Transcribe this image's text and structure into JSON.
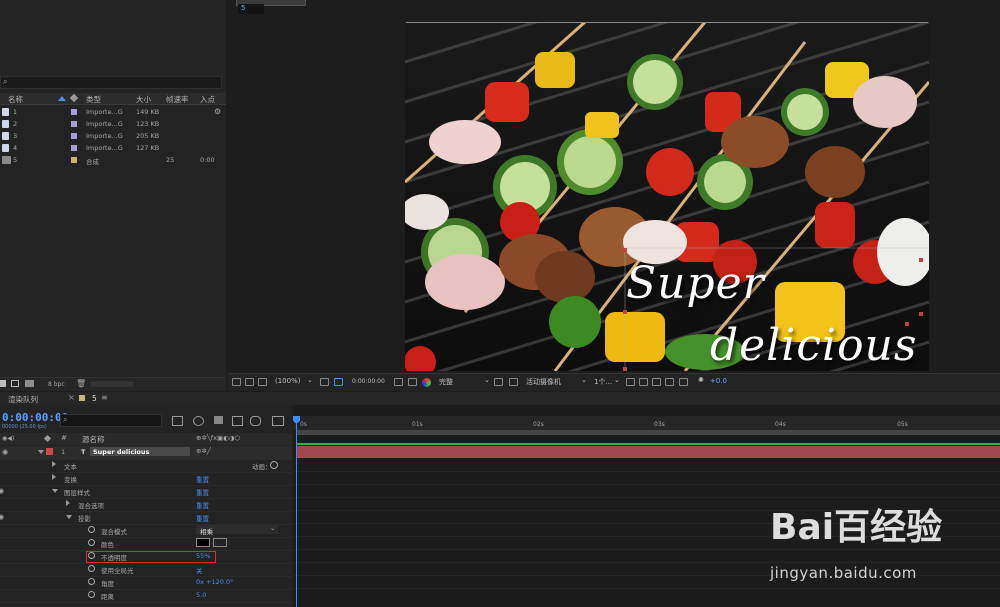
{
  "project": {
    "search_placeholder": "",
    "columns": [
      "名称",
      "类型",
      "大小",
      "帧速率",
      "入点"
    ],
    "items": [
      {
        "name": "1",
        "type": "Importe...G",
        "size": "149 KB",
        "fps": "",
        "in": ""
      },
      {
        "name": "2",
        "type": "Importe...G",
        "size": "123 KB",
        "fps": "",
        "in": ""
      },
      {
        "name": "3",
        "type": "Importe...G",
        "size": "205 KB",
        "fps": "",
        "in": ""
      },
      {
        "name": "4",
        "type": "Importe...G",
        "size": "127 KB",
        "fps": "",
        "in": ""
      },
      {
        "name": "5",
        "type": "合成",
        "size": "",
        "fps": "25",
        "in": "0:00"
      }
    ],
    "footer_bpc": "8 bpc"
  },
  "viewer": {
    "tab_field": "5",
    "canvas_text_line1": "Super",
    "canvas_text_line2": "delicious",
    "zoom": "(100%)",
    "timecode": "0:00:00:00",
    "quality": "完整",
    "camera": "活动摄像机",
    "views": "1个...",
    "exposure": "+0.0"
  },
  "timeline": {
    "tab_render_queue": "渲染队列",
    "tab_comp": "5",
    "timecode": "0:00:00:00",
    "timecode_sub": "00000 (25.00 fps)",
    "col_source_name": "源名称",
    "ruler": [
      "0s",
      "01s",
      "02s",
      "03s",
      "04s",
      "05s"
    ],
    "layer": {
      "index": "1",
      "name": "Super   delicious"
    },
    "properties": [
      {
        "label": "文本",
        "value": "",
        "extra": "动画："
      },
      {
        "label": "变换",
        "value": "重置"
      },
      {
        "label": "图层样式",
        "value": "重置"
      },
      {
        "label": "混合选项",
        "value": "重置"
      },
      {
        "label": "投影",
        "value": "重置"
      },
      {
        "label": "混合模式",
        "value": "相乘"
      },
      {
        "label": "颜色",
        "value": ""
      },
      {
        "label": "不透明度",
        "value": "55%"
      },
      {
        "label": "使用全局光",
        "value": "关"
      },
      {
        "label": "角度",
        "value": "0x +120.0°"
      },
      {
        "label": "距离",
        "value": "5.0"
      }
    ]
  },
  "watermark": {
    "brand": "Bai百经验",
    "url": "jingyan.baidu.com"
  },
  "colors": {
    "accent": "#3f8cff",
    "layer_bar": "#a1484d",
    "highlight": "#d03030"
  }
}
